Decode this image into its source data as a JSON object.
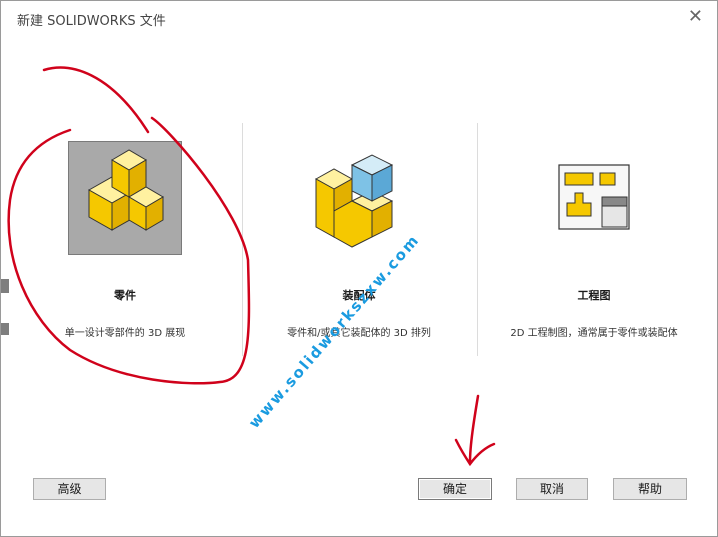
{
  "dialog": {
    "title": "新建 SOLIDWORKS 文件",
    "close_glyph": "✕"
  },
  "templates": [
    {
      "name": "零件",
      "description": "单一设计零部件的 3D 展现",
      "icon": "part-icon",
      "selected": true
    },
    {
      "name": "装配体",
      "description": "零件和/或其它装配体的 3D 排列",
      "icon": "assembly-icon",
      "selected": false
    },
    {
      "name": "工程图",
      "description": "2D 工程制图，通常属于零件或装配体",
      "icon": "drawing-icon",
      "selected": false
    }
  ],
  "buttons": {
    "advanced": "高级",
    "ok": "确定",
    "cancel": "取消",
    "help": "帮助"
  },
  "watermark": "www.solidworkszxw.com",
  "colors": {
    "selection_bg": "#a9a9a9",
    "part_yellow": "#f5c800",
    "assembly_blue": "#7ec2e6",
    "annotation_red": "#d0021b",
    "watermark_blue": "#1a9be0"
  }
}
